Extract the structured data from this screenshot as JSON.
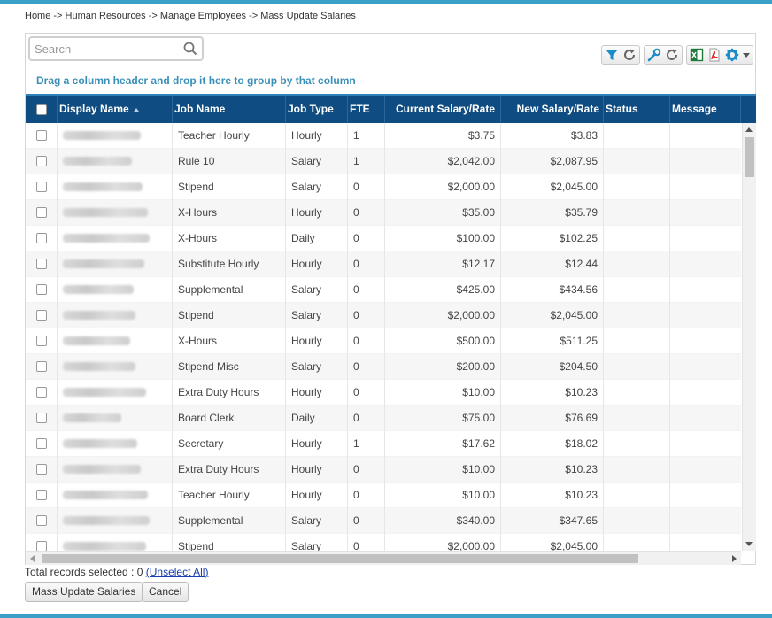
{
  "breadcrumb": "Home -> Human Resources -> Manage Employees -> Mass Update Salaries",
  "search": {
    "placeholder": "Search"
  },
  "toolbar": {
    "icons": [
      "filter-icon",
      "refresh-icon",
      "wrench-icon",
      "refresh-icon",
      "excel-icon",
      "pdf-icon",
      "gear-icon",
      "dropdown-caret-icon"
    ]
  },
  "group_hint": "Drag a column header and drop it here to group by that column",
  "columns": [
    "Display Name",
    "Job Name",
    "Job Type",
    "FTE",
    "Current Salary/Rate",
    "New Salary/Rate",
    "Status",
    "Message"
  ],
  "rows": [
    {
      "job_name": "Teacher Hourly",
      "job_type": "Hourly",
      "fte": "1",
      "current": "$3.75",
      "new": "$3.83"
    },
    {
      "job_name": "Rule 10",
      "job_type": "Salary",
      "fte": "1",
      "current": "$2,042.00",
      "new": "$2,087.95"
    },
    {
      "job_name": "Stipend",
      "job_type": "Salary",
      "fte": "0",
      "current": "$2,000.00",
      "new": "$2,045.00"
    },
    {
      "job_name": "X-Hours",
      "job_type": "Hourly",
      "fte": "0",
      "current": "$35.00",
      "new": "$35.79"
    },
    {
      "job_name": "X-Hours",
      "job_type": "Daily",
      "fte": "0",
      "current": "$100.00",
      "new": "$102.25"
    },
    {
      "job_name": "Substitute Hourly",
      "job_type": "Hourly",
      "fte": "0",
      "current": "$12.17",
      "new": "$12.44"
    },
    {
      "job_name": "Supplemental",
      "job_type": "Salary",
      "fte": "0",
      "current": "$425.00",
      "new": "$434.56"
    },
    {
      "job_name": "Stipend",
      "job_type": "Salary",
      "fte": "0",
      "current": "$2,000.00",
      "new": "$2,045.00"
    },
    {
      "job_name": "X-Hours",
      "job_type": "Hourly",
      "fte": "0",
      "current": "$500.00",
      "new": "$511.25"
    },
    {
      "job_name": "Stipend Misc",
      "job_type": "Salary",
      "fte": "0",
      "current": "$200.00",
      "new": "$204.50"
    },
    {
      "job_name": "Extra Duty Hours",
      "job_type": "Hourly",
      "fte": "0",
      "current": "$10.00",
      "new": "$10.23"
    },
    {
      "job_name": "Board Clerk",
      "job_type": "Daily",
      "fte": "0",
      "current": "$75.00",
      "new": "$76.69"
    },
    {
      "job_name": "Secretary",
      "job_type": "Hourly",
      "fte": "1",
      "current": "$17.62",
      "new": "$18.02"
    },
    {
      "job_name": "Extra Duty Hours",
      "job_type": "Hourly",
      "fte": "0",
      "current": "$10.00",
      "new": "$10.23"
    },
    {
      "job_name": "Teacher Hourly",
      "job_type": "Hourly",
      "fte": "0",
      "current": "$10.00",
      "new": "$10.23"
    },
    {
      "job_name": "Supplemental",
      "job_type": "Salary",
      "fte": "0",
      "current": "$340.00",
      "new": "$347.65"
    },
    {
      "job_name": "Stipend",
      "job_type": "Salary",
      "fte": "0",
      "current": "$2,000.00",
      "new": "$2,045.00"
    }
  ],
  "footer": {
    "label": "Total records selected : 0",
    "unselect": "(Unselect All)"
  },
  "buttons": {
    "mass_update": "Mass Update Salaries",
    "cancel": "Cancel"
  },
  "colors": {
    "header_bg": "#0f4c81",
    "accent": "#3aa0c8",
    "hint_text": "#3a8fb8"
  }
}
